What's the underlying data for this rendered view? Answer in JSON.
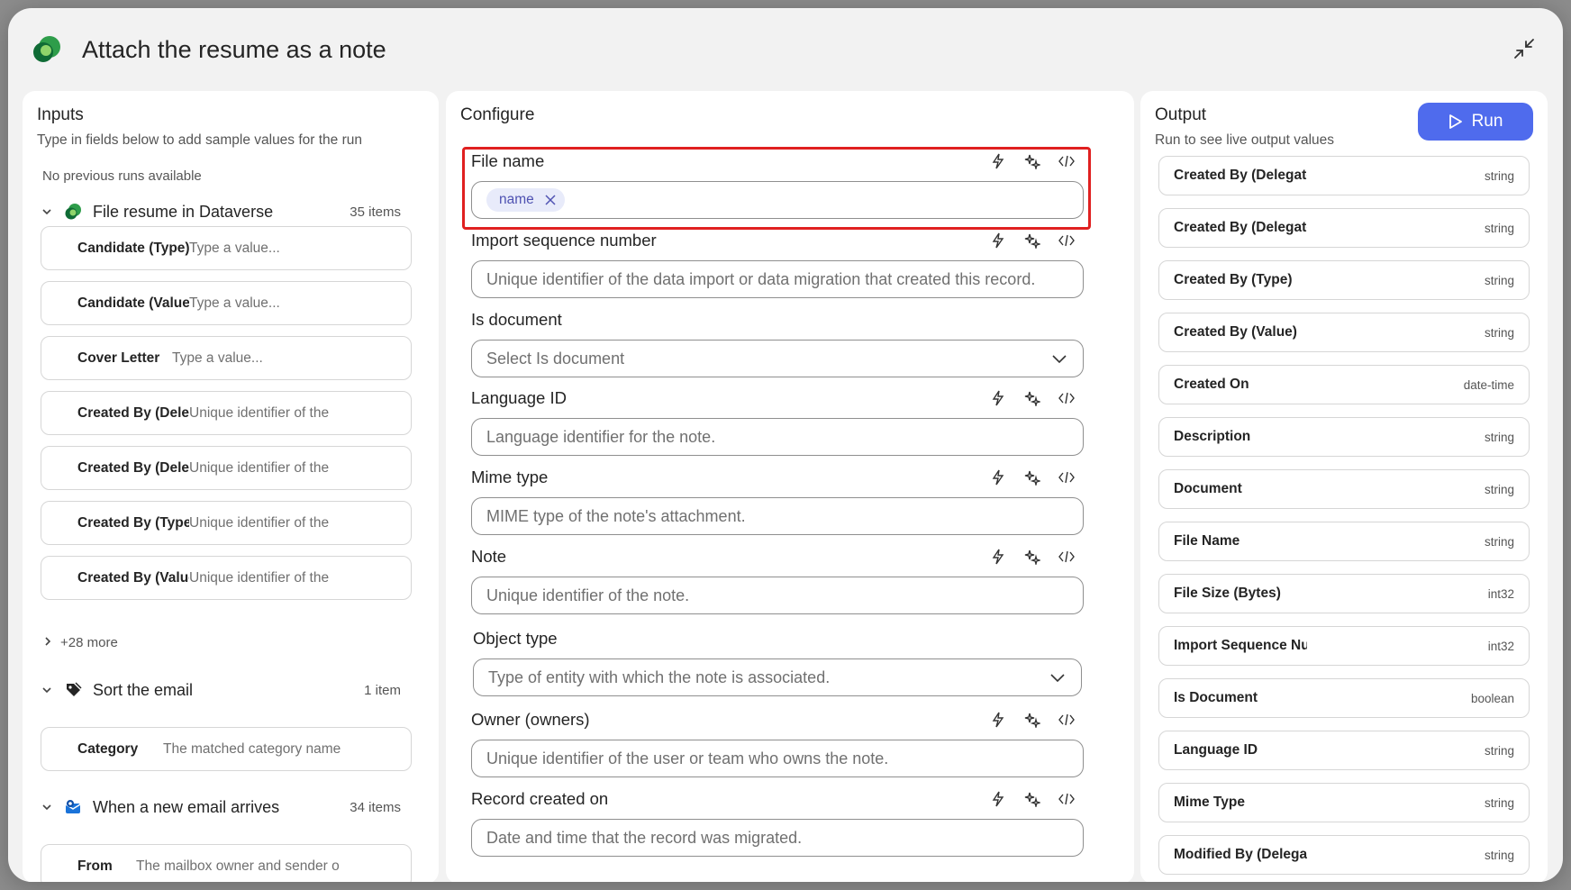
{
  "modal": {
    "title": "Attach the resume as a note"
  },
  "inputs": {
    "title": "Inputs",
    "subtitle": "Type in fields below to add sample values for the run",
    "no_runs": "No previous runs available",
    "groups": [
      {
        "name": "File resume in Dataverse",
        "count": "35 items",
        "fields": [
          {
            "label": "Candidate (Type)",
            "placeholder": "Type a value..."
          },
          {
            "label": "Candidate (Value",
            "placeholder": "Type a value..."
          },
          {
            "label": "Cover Letter",
            "placeholder": "Type a value..."
          },
          {
            "label": "Created By (Delegate",
            "placeholder": "Unique identifier of the"
          },
          {
            "label": "Created By (Delegate",
            "placeholder": "Unique identifier of the"
          },
          {
            "label": "Created By (Type",
            "placeholder": "Unique identifier of the"
          },
          {
            "label": "Created By (Value",
            "placeholder": "Unique identifier of the"
          }
        ],
        "more": "+28 more"
      },
      {
        "name": "Sort the email",
        "count": "1 item",
        "fields": [
          {
            "label": "Category",
            "placeholder": "The matched category name"
          }
        ]
      },
      {
        "name": "When a new email arrives",
        "count": "34 items",
        "fields": [
          {
            "label": "From",
            "placeholder": "The mailbox owner and sender o"
          }
        ]
      }
    ]
  },
  "configure": {
    "title": "Configure",
    "fields": [
      {
        "label": "File name",
        "chip": "name"
      },
      {
        "label": "Import sequence number",
        "placeholder": "Unique identifier of the data import or data migration that created this record."
      },
      {
        "label": "Is document",
        "placeholder": "Select Is document"
      },
      {
        "label": "Language ID",
        "placeholder": "Language identifier for the note."
      },
      {
        "label": "Mime type",
        "placeholder": "MIME type of the note's attachment."
      },
      {
        "label": "Note",
        "placeholder": "Unique identifier of the note."
      },
      {
        "label": "Object type",
        "placeholder": "Type of entity with which the note is associated."
      },
      {
        "label": "Owner (owners)",
        "placeholder": "Unique identifier of the user or team who owns the note."
      },
      {
        "label": "Record created on",
        "placeholder": "Date and time that the record was migrated."
      }
    ]
  },
  "output": {
    "title": "Output",
    "subtitle": "Run to see live output values",
    "run_label": "Run",
    "items": [
      {
        "name": "Created By (Delegate",
        "type": "string"
      },
      {
        "name": "Created By (Delegate",
        "type": "string"
      },
      {
        "name": "Created By (Type)",
        "type": "string"
      },
      {
        "name": "Created By (Value)",
        "type": "string"
      },
      {
        "name": "Created On",
        "type": "date-time"
      },
      {
        "name": "Description",
        "type": "string"
      },
      {
        "name": "Document",
        "type": "string"
      },
      {
        "name": "File Name",
        "type": "string"
      },
      {
        "name": "File Size (Bytes)",
        "type": "int32"
      },
      {
        "name": "Import Sequence Number",
        "type": "int32"
      },
      {
        "name": "Is Document",
        "type": "boolean"
      },
      {
        "name": "Language ID",
        "type": "string"
      },
      {
        "name": "Mime Type",
        "type": "string"
      },
      {
        "name": "Modified By (Delegate",
        "type": "string"
      }
    ]
  },
  "colors": {
    "accent": "#4f6bed",
    "highlight": "#e02020",
    "chip_bg": "#e8ebfa",
    "chip_text": "#4f52b2"
  }
}
